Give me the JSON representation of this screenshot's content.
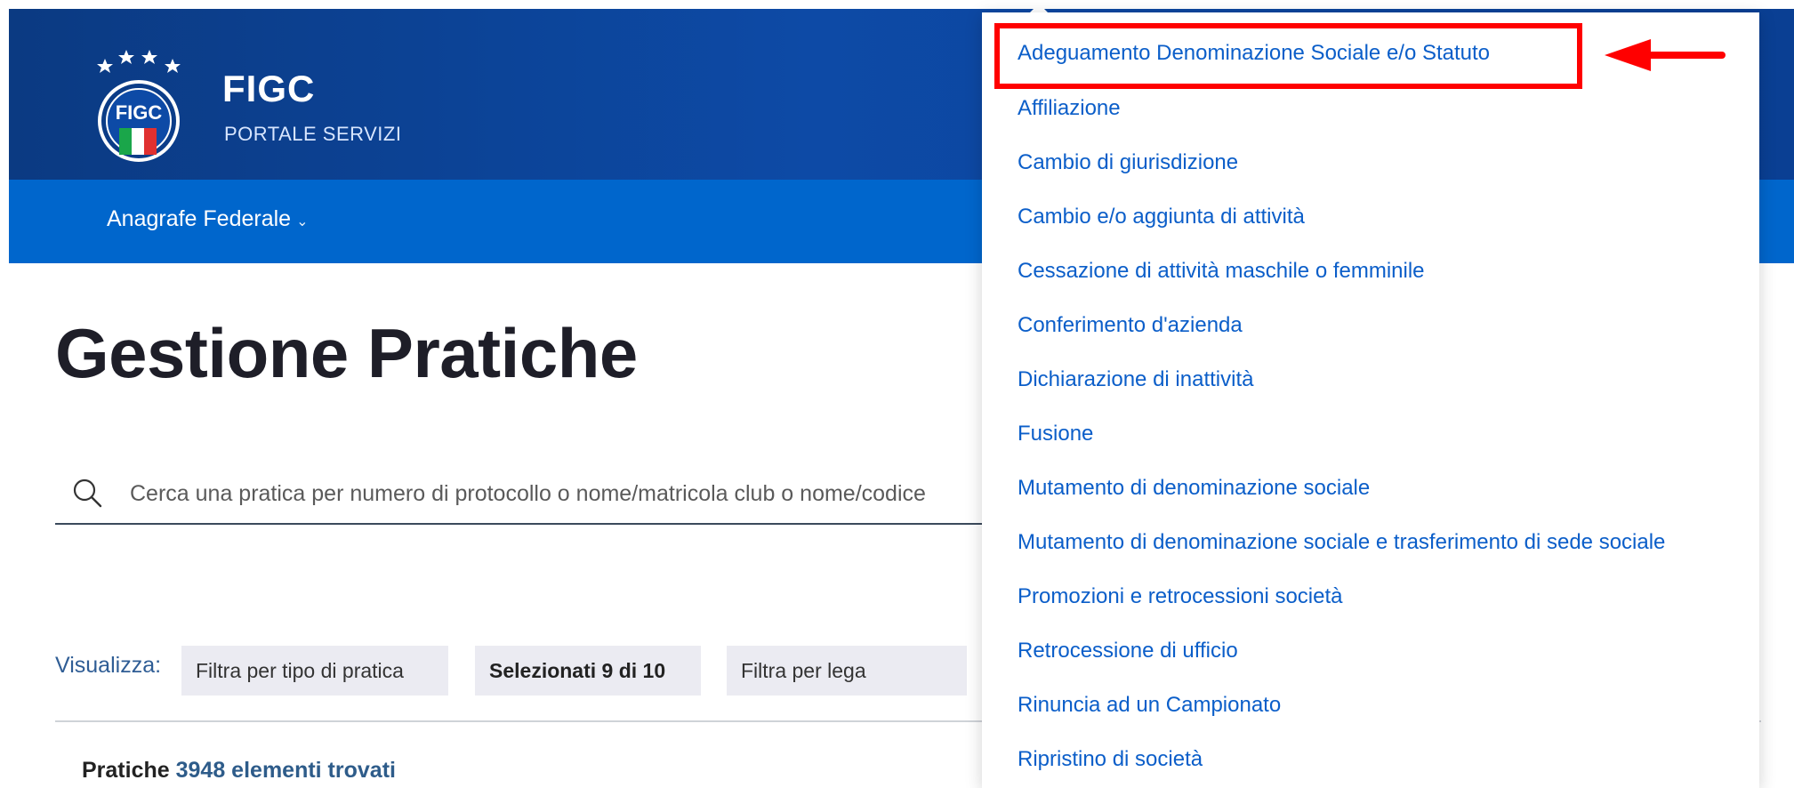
{
  "header": {
    "brand_title": "FIGC",
    "brand_subtitle": "PORTALE SERVIZI",
    "logo_text": "FIGC"
  },
  "nav": {
    "items": [
      {
        "label": "Anagrafe Federale",
        "icon": "chevron-down-icon"
      }
    ]
  },
  "page": {
    "title": "Gestione Pratiche"
  },
  "search": {
    "placeholder": "Cerca una pratica per numero di protocollo o nome/matricola club o nome/codice"
  },
  "filters": {
    "label": "Visualizza:",
    "chips": [
      {
        "label": "Filtra per tipo di pratica"
      },
      {
        "label": "Selezionati 9 di 10"
      },
      {
        "label": "Filtra per lega"
      }
    ]
  },
  "results": {
    "prefix": "Pratiche",
    "count_text": "3948 elementi trovati"
  },
  "dropdown": {
    "items": [
      {
        "label": "Adeguamento Denominazione Sociale e/o Statuto"
      },
      {
        "label": "Affiliazione"
      },
      {
        "label": "Cambio di giurisdizione"
      },
      {
        "label": "Cambio e/o aggiunta di attività"
      },
      {
        "label": "Cessazione di attività maschile o femminile"
      },
      {
        "label": "Conferimento d'azienda"
      },
      {
        "label": "Dichiarazione di inattività"
      },
      {
        "label": "Fusione"
      },
      {
        "label": "Mutamento di denominazione sociale"
      },
      {
        "label": "Mutamento di denominazione sociale e trasferimento di sede sociale"
      },
      {
        "label": "Promozioni e retrocessioni società"
      },
      {
        "label": "Retrocessione di ufficio"
      },
      {
        "label": "Rinuncia ad un Campionato"
      },
      {
        "label": "Ripristino di società"
      }
    ]
  },
  "colors": {
    "header_bg": "#0d4aa6",
    "nav_bg": "#0066cc",
    "link": "#0b5ec9",
    "annotation_red": "#ff0000"
  }
}
